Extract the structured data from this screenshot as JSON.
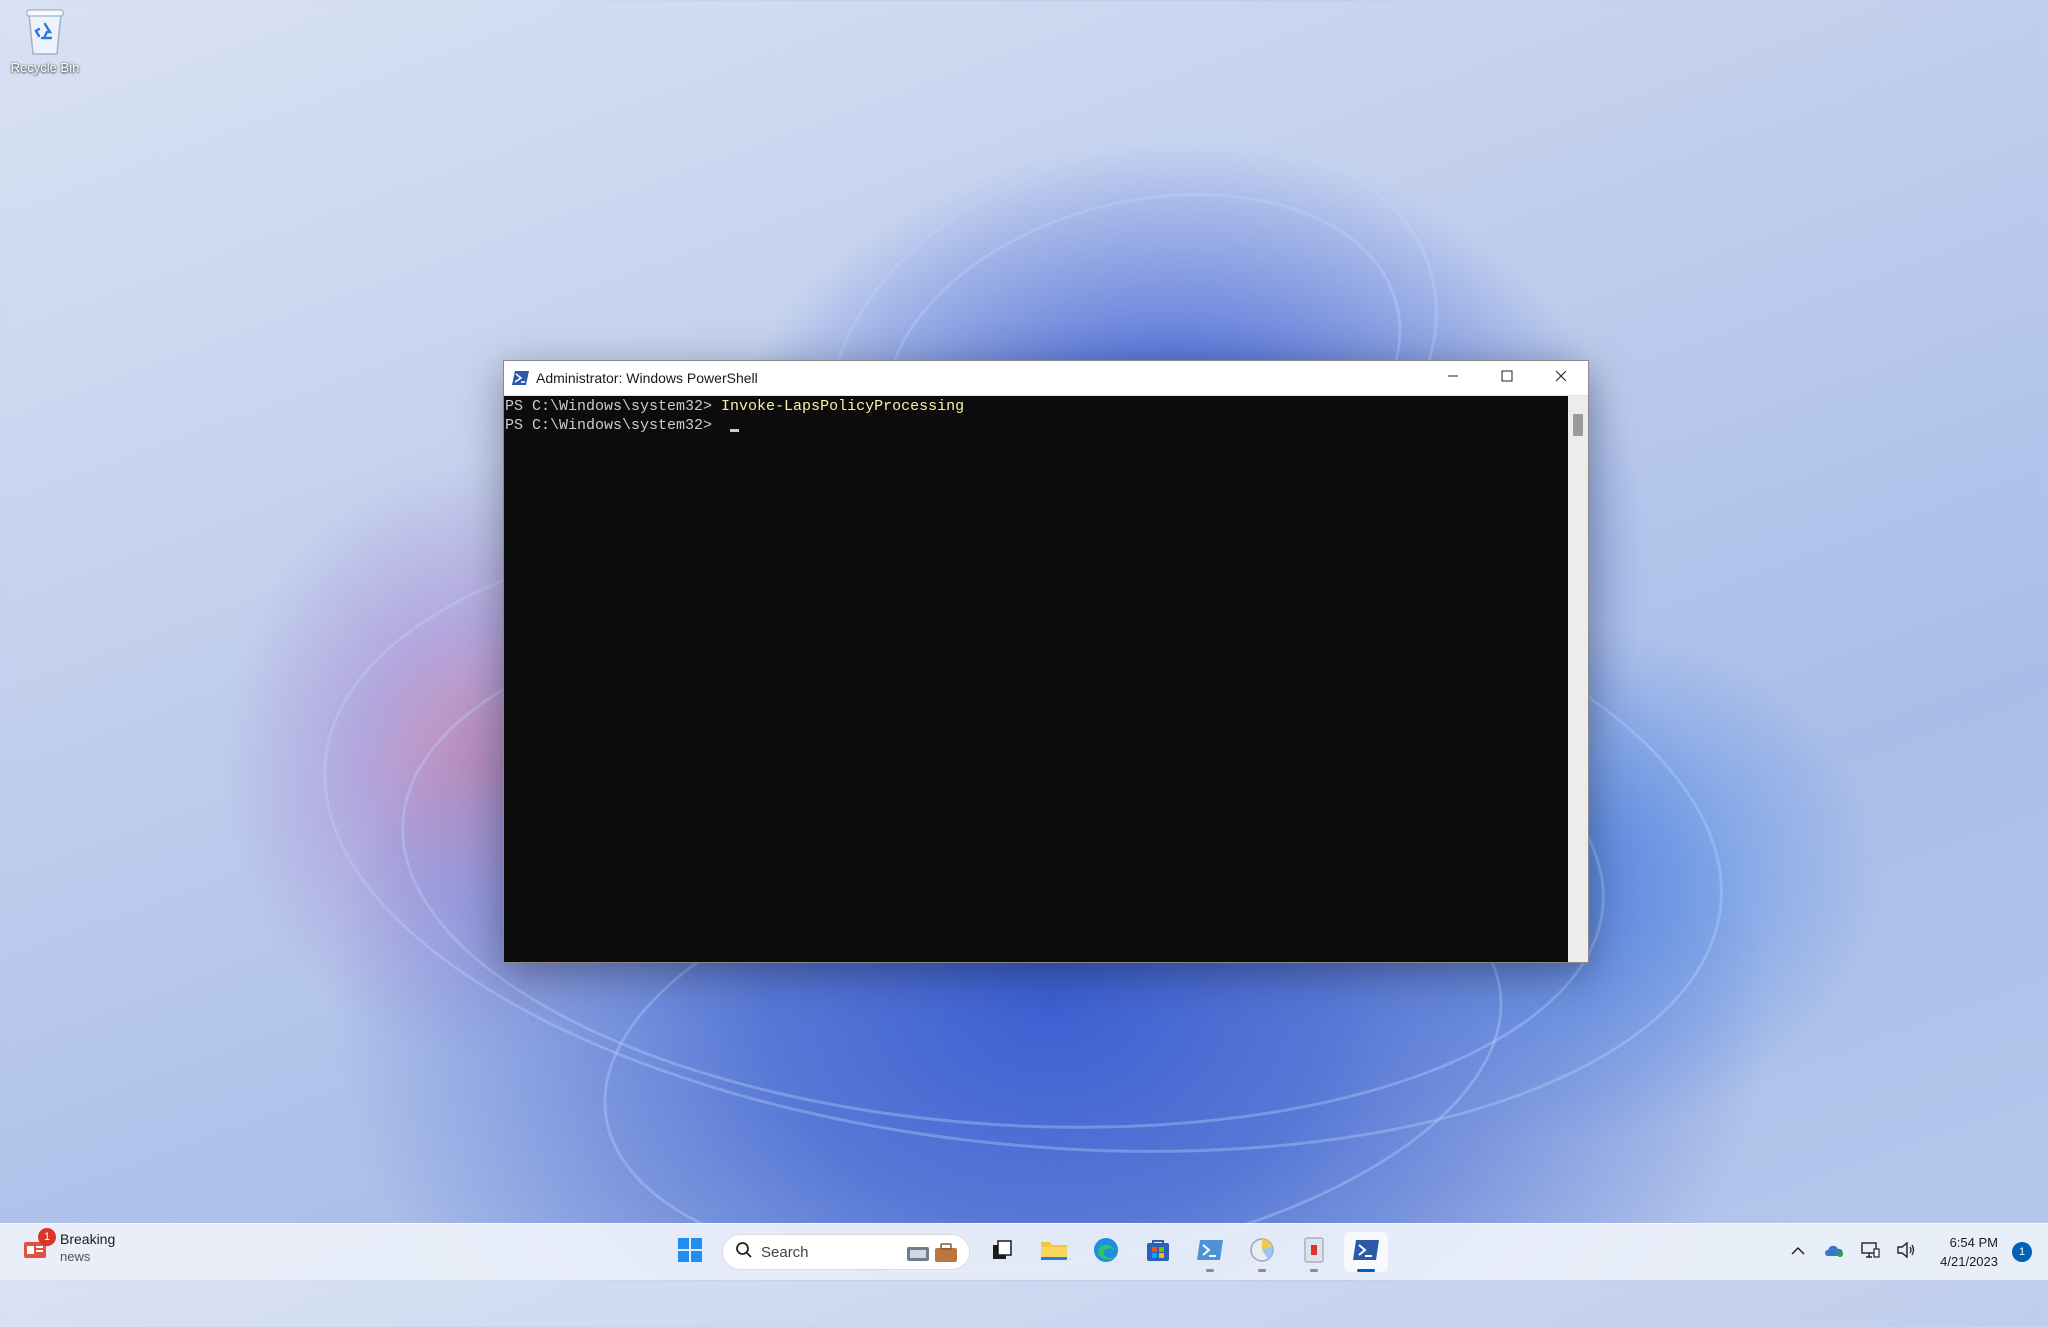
{
  "desktop": {
    "icons": [
      {
        "label": "Recycle Bin",
        "icon": "recycle-bin-icon"
      }
    ]
  },
  "window": {
    "title": "Administrator: Windows PowerShell",
    "icon": "powershell-icon",
    "controls": {
      "minimize": "minimize-icon",
      "maximize": "maximize-icon",
      "close": "close-icon"
    },
    "console": {
      "lines": [
        {
          "prompt": "PS C:\\Windows\\system32> ",
          "command": "Invoke-LapsPolicyProcessing"
        },
        {
          "prompt": "PS C:\\Windows\\system32> ",
          "command": ""
        }
      ],
      "colors": {
        "background": "#0c0c0c",
        "text": "#cccccc",
        "command": "#f9f1a5"
      }
    }
  },
  "taskbar": {
    "widget": {
      "title": "Breaking",
      "subtitle": "news",
      "badge": "1",
      "icon": "news-widget-icon"
    },
    "search": {
      "placeholder": "Search"
    },
    "apps": [
      {
        "name": "start-button",
        "icon": "windows-start-icon"
      },
      {
        "name": "task-view",
        "icon": "task-view-icon"
      },
      {
        "name": "file-explorer",
        "icon": "folder-icon"
      },
      {
        "name": "edge",
        "icon": "edge-icon"
      },
      {
        "name": "store",
        "icon": "store-icon"
      },
      {
        "name": "powershell-ise",
        "icon": "powershell-ise-icon"
      },
      {
        "name": "control-panel",
        "icon": "control-panel-icon"
      },
      {
        "name": "event-viewer",
        "icon": "event-viewer-icon"
      },
      {
        "name": "powershell",
        "icon": "powershell-icon"
      }
    ],
    "tray": {
      "icons": [
        "chevron-up-icon",
        "onedrive-icon",
        "network-icon",
        "volume-icon"
      ],
      "time": "6:54 PM",
      "date": "4/21/2023",
      "notifications": "1"
    },
    "accent": "#005fb8"
  }
}
